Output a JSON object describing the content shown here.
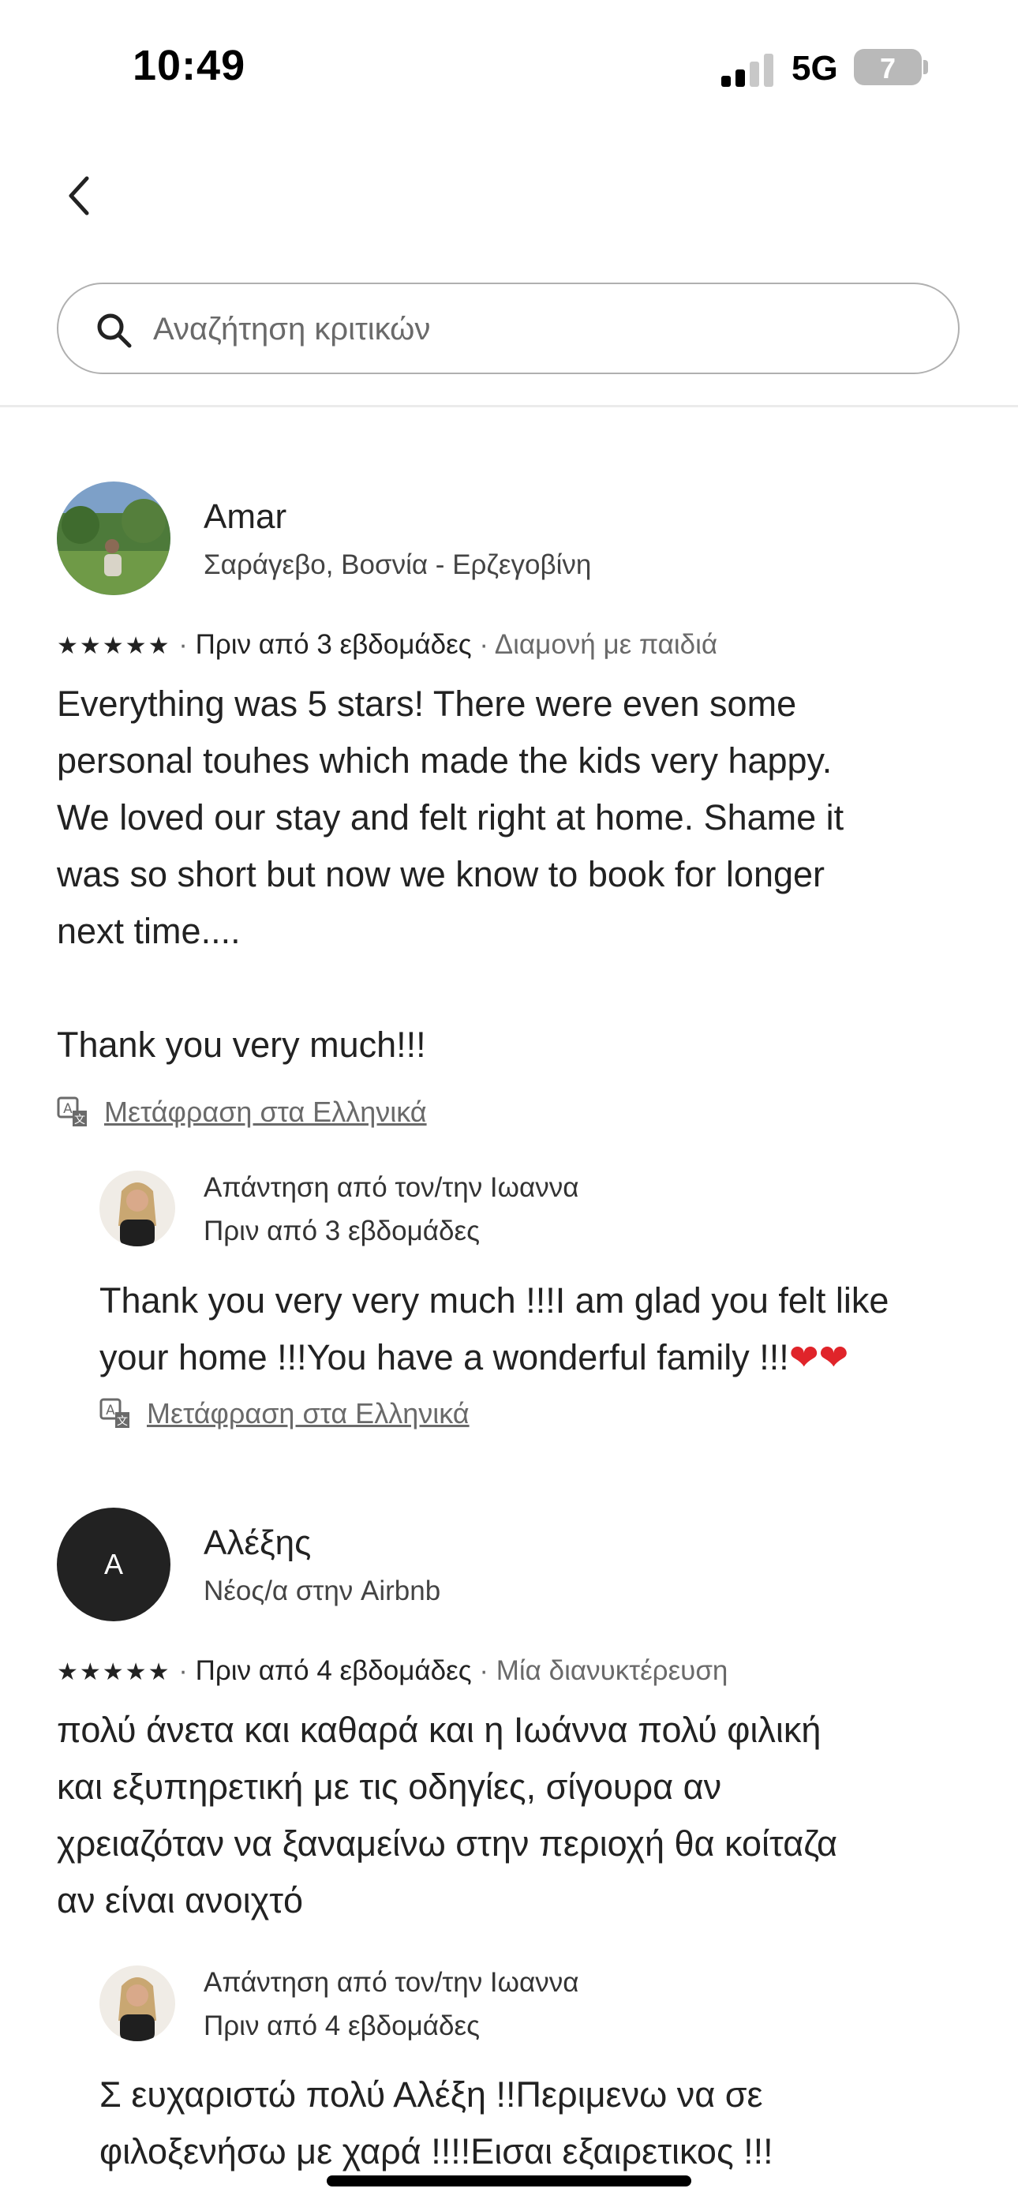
{
  "status_bar": {
    "time": "10:49",
    "network": "5G",
    "battery": "7"
  },
  "search": {
    "placeholder": "Αναζήτηση κριτικών"
  },
  "reviews": [
    {
      "name": "Amar",
      "location": "Σαράγεβο, Βοσνία - Ερζεγοβίνη",
      "rating": 5,
      "stars": "★★★★★",
      "when": "Πριν από 3 εβδομάδες",
      "trip_type": "Διαμονή με παιδιά",
      "text_lines": [
        "Everything was 5 stars! There were even some",
        "personal touhes which made the kids very happy.",
        "We loved our stay and felt right at home. Shame it",
        "was so short but now we know to book for longer",
        "next time....",
        "",
        "Thank you very much!!!"
      ],
      "translate_label": "Μετάφραση στα Ελληνικά",
      "response": {
        "header": "Απάντηση από τον/την Ιωαννα",
        "when": "Πριν από 3 εβδομάδες",
        "text_lines": [
          "Thank you very very much !!!I am glad you felt like",
          "your home !!!You have a wonderful family !!!"
        ],
        "hearts": "❤❤",
        "translate_label": "Μετάφραση στα Ελληνικά"
      }
    },
    {
      "name": "Αλέξης",
      "avatar_letter": "A",
      "location": "Νέος/α στην Airbnb",
      "rating": 5,
      "stars": "★★★★★",
      "when": "Πριν από 4 εβδομάδες",
      "trip_type": "Μία διανυκτέρευση",
      "text_lines": [
        "πολύ άνετα και καθαρά και η Ιωάννα πολύ φιλική",
        "και εξυπηρετική με τις οδηγίες, σίγουρα αν",
        "χρειαζόταν να ξαναμείνω στην περιοχή θα κοίταζα",
        "αν είναι ανοιχτό"
      ],
      "response": {
        "header": "Απάντηση από τον/την Ιωαννα",
        "when": "Πριν από 4 εβδομάδες",
        "text_lines": [
          "Σ ευχαριστώ πολύ Αλέξη !!Περιμενω να σε",
          "φιλοξενήσω με χαρά !!!!Εισαι εξαιρετικος  !!!"
        ]
      }
    }
  ],
  "colors": {
    "text": "#222222",
    "secondary": "#6a6a6a",
    "border": "#b0b0b0",
    "avatar_dark": "#222222"
  },
  "icons": [
    "chevron-left-icon",
    "search-icon",
    "translate-icon",
    "star-icon",
    "heart-icon"
  ]
}
